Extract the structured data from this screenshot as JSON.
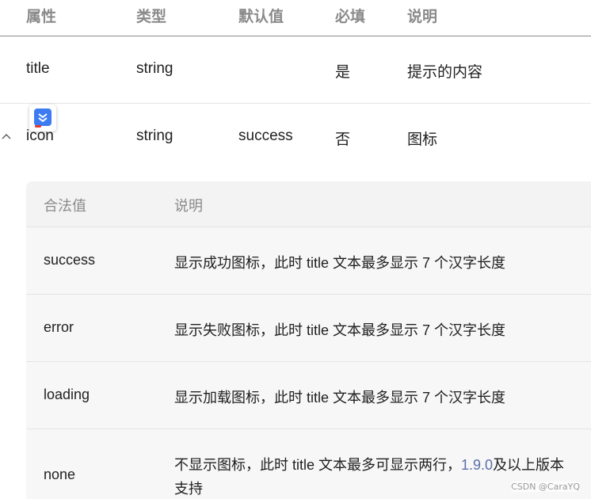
{
  "props_table": {
    "headers": [
      "属性",
      "类型",
      "默认值",
      "必填",
      "说明"
    ],
    "rows": [
      {
        "name": "title",
        "type": "string",
        "default": "",
        "required": "是",
        "desc": "提示的内容"
      },
      {
        "name": "icon",
        "type": "string",
        "default": "success",
        "required": "否",
        "desc": "图标"
      }
    ]
  },
  "icon_values_table": {
    "headers": [
      "合法值",
      "说明"
    ],
    "rows": [
      {
        "value": "success",
        "desc": "显示成功图标，此时 title 文本最多显示 7 个汉字长度"
      },
      {
        "value": "error",
        "desc": "显示失败图标，此时 title 文本最多显示 7 个汉字长度"
      },
      {
        "value": "loading",
        "desc": "显示加载图标，此时 title 文本最多显示 7 个汉字长度"
      },
      {
        "value": "none",
        "desc_before": "不显示图标，此时 title 文本最多可显示两行，",
        "desc_version": "1.9.0",
        "desc_after": "及以上版本",
        "desc_line2": "支持"
      }
    ]
  },
  "icons": {
    "collapse": "chevron-up-icon",
    "app_badge": "download-app-icon"
  },
  "colors": {
    "link": "#5a6fa8",
    "badge": "#3d7bf2"
  },
  "watermark": "CSDN @CaraYQ"
}
